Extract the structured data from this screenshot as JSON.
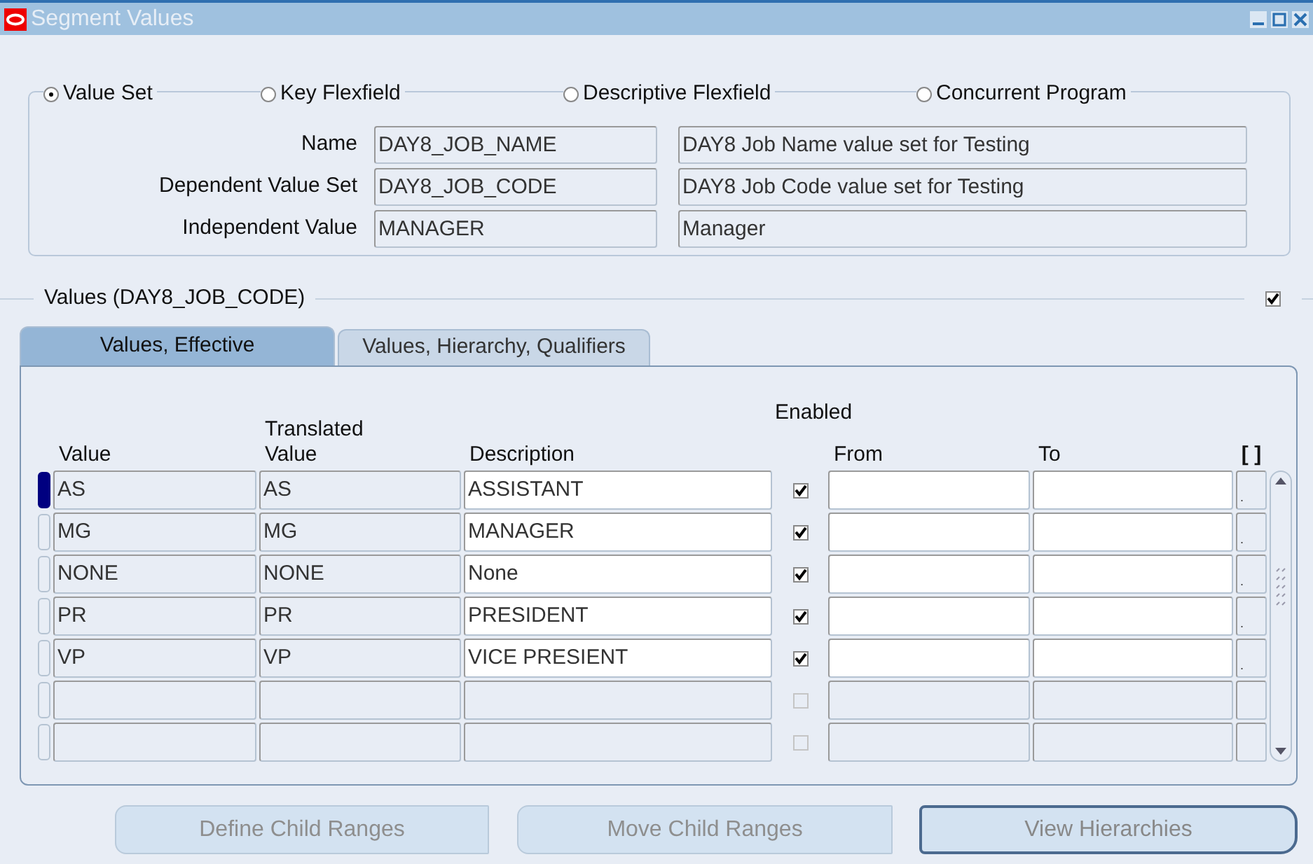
{
  "window": {
    "title": "Segment Values"
  },
  "type_options": [
    {
      "label": "Value Set",
      "selected": true
    },
    {
      "label": "Key Flexfield",
      "selected": false
    },
    {
      "label": "Descriptive Flexfield",
      "selected": false
    },
    {
      "label": "Concurrent Program",
      "selected": false
    }
  ],
  "fields": [
    {
      "label": "Name",
      "value": "DAY8_JOB_NAME",
      "description": "DAY8 Job Name value set for Testing"
    },
    {
      "label": "Dependent Value Set",
      "value": "DAY8_JOB_CODE",
      "description": "DAY8 Job Code value set for Testing"
    },
    {
      "label": "Independent Value",
      "value": "MANAGER",
      "description": "Manager"
    }
  ],
  "values_section": {
    "title": "Values (DAY8_JOB_CODE)",
    "checked": true
  },
  "tabs": [
    {
      "label": "Values, Effective",
      "selected": true
    },
    {
      "label": "Values, Hierarchy, Qualifiers",
      "selected": false
    }
  ],
  "table": {
    "columns": [
      "Value",
      "Translated Value",
      "Description",
      "Enabled",
      "From",
      "To",
      "[ ]"
    ],
    "rows": [
      {
        "value": "AS",
        "translated_value": "AS",
        "description": "ASSISTANT",
        "enabled": true,
        "editable": true,
        "column_7": ".",
        "selected": true
      },
      {
        "value": "MG",
        "translated_value": "MG",
        "description": "MANAGER",
        "enabled": true,
        "editable": true,
        "column_7": ".",
        "selected": false
      },
      {
        "value": "NONE",
        "translated_value": "NONE",
        "description": "None",
        "enabled": true,
        "editable": true,
        "column_7": ".",
        "selected": false
      },
      {
        "value": "PR",
        "translated_value": "PR",
        "description": "PRESIDENT",
        "enabled": true,
        "editable": true,
        "column_7": ".",
        "selected": false
      },
      {
        "value": "VP",
        "translated_value": "VP",
        "description": "VICE PRESIENT",
        "enabled": true,
        "editable": true,
        "column_7": ".",
        "selected": false
      },
      {
        "enabled": false,
        "editable": false,
        "selected": false
      },
      {
        "enabled": false,
        "editable": false,
        "selected": false
      }
    ]
  },
  "buttons": [
    {
      "label": "Define Child Ranges",
      "disabled": true
    },
    {
      "label": "Move Child Ranges",
      "disabled": true
    },
    {
      "label": "View Hierarchies",
      "disabled": false
    }
  ]
}
